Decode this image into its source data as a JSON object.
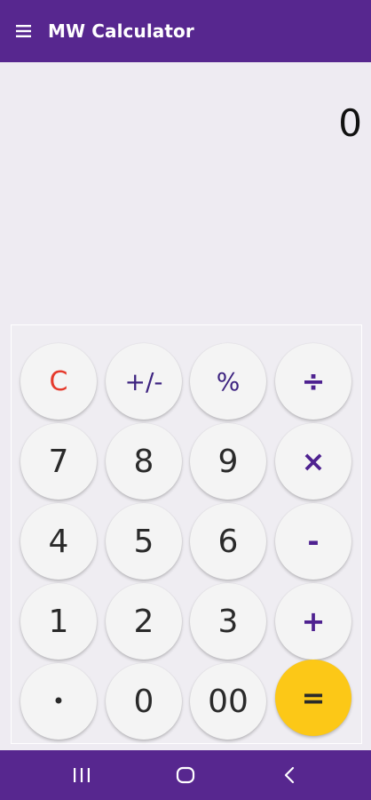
{
  "app_bar": {
    "title": "MW Calculator",
    "menu_icon": "hamburger-menu-icon",
    "background": "#57278f"
  },
  "display": {
    "value": "0"
  },
  "keypad": {
    "rows": [
      [
        "C",
        "+/-",
        "%",
        "÷"
      ],
      [
        "7",
        "8",
        "9",
        "×"
      ],
      [
        "4",
        "5",
        "6",
        "-"
      ],
      [
        "1",
        "2",
        "3",
        "+"
      ],
      [
        "•",
        "0",
        "00",
        "="
      ]
    ]
  },
  "nav_bar": {
    "icons": [
      "recent-apps-icon",
      "home-icon",
      "back-icon"
    ]
  },
  "colors": {
    "accent": "#57278f",
    "equals": "#fcc817",
    "clear": "#e53a2c",
    "operator": "#4e2190"
  }
}
